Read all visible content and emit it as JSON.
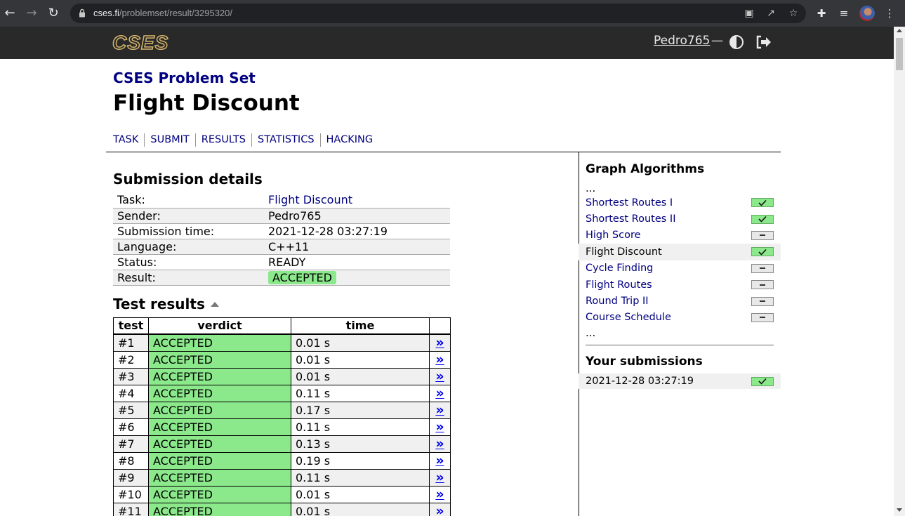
{
  "browser": {
    "url_host": "cses.fi",
    "url_path": "/problemset/result/3295320/"
  },
  "header": {
    "logo": "CSES",
    "username": "Pedro765",
    "dash": "—"
  },
  "page": {
    "section_title": "CSES Problem Set",
    "title": "Flight Discount",
    "tabs": [
      "TASK",
      "SUBMIT",
      "RESULTS",
      "STATISTICS",
      "HACKING"
    ]
  },
  "details": {
    "heading": "Submission details",
    "rows": [
      {
        "key": "Task:",
        "value": "Flight Discount"
      },
      {
        "key": "Sender:",
        "value": "Pedro765"
      },
      {
        "key": "Submission time:",
        "value": "2021-12-28 03:27:19"
      },
      {
        "key": "Language:",
        "value": "C++11"
      },
      {
        "key": "Status:",
        "value": "READY"
      },
      {
        "key": "Result:",
        "value": "ACCEPTED"
      }
    ]
  },
  "tests": {
    "heading": "Test results",
    "columns": [
      "test",
      "verdict",
      "time"
    ],
    "link_glyph": "»",
    "rows": [
      {
        "test": "#1",
        "verdict": "ACCEPTED",
        "time": "0.01 s"
      },
      {
        "test": "#2",
        "verdict": "ACCEPTED",
        "time": "0.01 s"
      },
      {
        "test": "#3",
        "verdict": "ACCEPTED",
        "time": "0.01 s"
      },
      {
        "test": "#4",
        "verdict": "ACCEPTED",
        "time": "0.11 s"
      },
      {
        "test": "#5",
        "verdict": "ACCEPTED",
        "time": "0.17 s"
      },
      {
        "test": "#6",
        "verdict": "ACCEPTED",
        "time": "0.11 s"
      },
      {
        "test": "#7",
        "verdict": "ACCEPTED",
        "time": "0.13 s"
      },
      {
        "test": "#8",
        "verdict": "ACCEPTED",
        "time": "0.19 s"
      },
      {
        "test": "#9",
        "verdict": "ACCEPTED",
        "time": "0.11 s"
      },
      {
        "test": "#10",
        "verdict": "ACCEPTED",
        "time": "0.01 s"
      },
      {
        "test": "#11",
        "verdict": "ACCEPTED",
        "time": "0.01 s"
      }
    ]
  },
  "sidebar": {
    "heading": "Graph Algorithms",
    "ellipsis": "...",
    "items": [
      {
        "name": "Shortest Routes I",
        "status": "solved"
      },
      {
        "name": "Shortest Routes II",
        "status": "solved"
      },
      {
        "name": "High Score",
        "status": "unsolved"
      },
      {
        "name": "Flight Discount",
        "status": "solved",
        "current": true
      },
      {
        "name": "Cycle Finding",
        "status": "unsolved"
      },
      {
        "name": "Flight Routes",
        "status": "unsolved"
      },
      {
        "name": "Round Trip II",
        "status": "unsolved"
      },
      {
        "name": "Course Schedule",
        "status": "unsolved"
      }
    ],
    "submissions_heading": "Your submissions",
    "submissions": [
      {
        "time": "2021-12-28 03:27:19",
        "status": "solved"
      }
    ]
  },
  "colors": {
    "accepted": "#8be88b",
    "link": "#000080",
    "header_bg": "#292929"
  }
}
